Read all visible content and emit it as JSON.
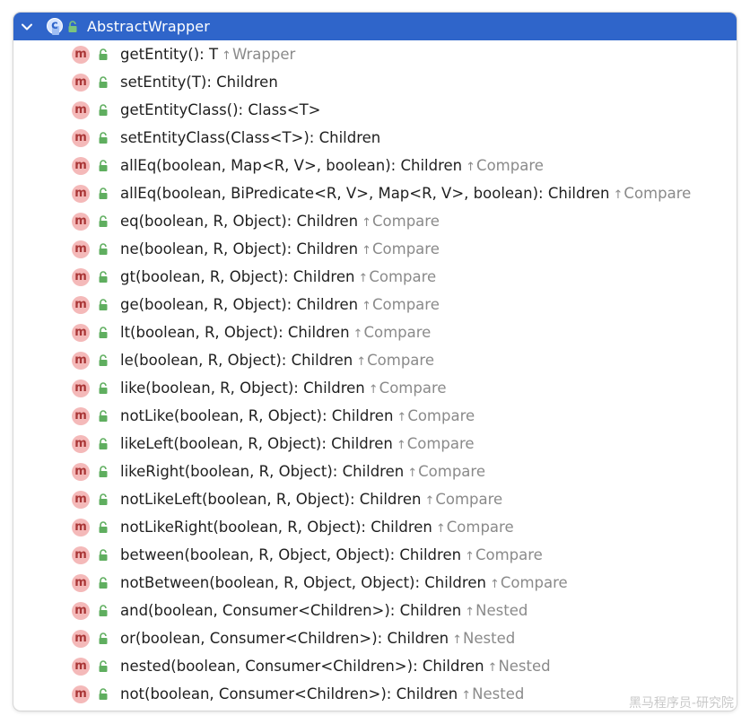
{
  "colors": {
    "header_bg": "#2f65ca",
    "method_icon": "#f4b9b9",
    "lock_green": "#5fae5f",
    "inherited_text": "#8a8a8a"
  },
  "header": {
    "class_icon_letter": "c",
    "title": "AbstractWrapper"
  },
  "method_icon_letter": "m",
  "methods": [
    {
      "signature": "getEntity(): T",
      "inherited": "Wrapper"
    },
    {
      "signature": "setEntity(T): Children",
      "inherited": ""
    },
    {
      "signature": "getEntityClass(): Class<T>",
      "inherited": ""
    },
    {
      "signature": "setEntityClass(Class<T>): Children",
      "inherited": ""
    },
    {
      "signature": "allEq(boolean, Map<R, V>, boolean): Children",
      "inherited": "Compare"
    },
    {
      "signature": "allEq(boolean, BiPredicate<R, V>, Map<R, V>, boolean): Children",
      "inherited": "Compare"
    },
    {
      "signature": "eq(boolean, R, Object): Children",
      "inherited": "Compare"
    },
    {
      "signature": "ne(boolean, R, Object): Children",
      "inherited": "Compare"
    },
    {
      "signature": "gt(boolean, R, Object): Children",
      "inherited": "Compare"
    },
    {
      "signature": "ge(boolean, R, Object): Children",
      "inherited": "Compare"
    },
    {
      "signature": "lt(boolean, R, Object): Children",
      "inherited": "Compare"
    },
    {
      "signature": "le(boolean, R, Object): Children",
      "inherited": "Compare"
    },
    {
      "signature": "like(boolean, R, Object): Children",
      "inherited": "Compare"
    },
    {
      "signature": "notLike(boolean, R, Object): Children",
      "inherited": "Compare"
    },
    {
      "signature": "likeLeft(boolean, R, Object): Children",
      "inherited": "Compare"
    },
    {
      "signature": "likeRight(boolean, R, Object): Children",
      "inherited": "Compare"
    },
    {
      "signature": "notLikeLeft(boolean, R, Object): Children",
      "inherited": "Compare"
    },
    {
      "signature": "notLikeRight(boolean, R, Object): Children",
      "inherited": "Compare"
    },
    {
      "signature": "between(boolean, R, Object, Object): Children",
      "inherited": "Compare"
    },
    {
      "signature": "notBetween(boolean, R, Object, Object): Children",
      "inherited": "Compare"
    },
    {
      "signature": "and(boolean, Consumer<Children>): Children",
      "inherited": "Nested"
    },
    {
      "signature": "or(boolean, Consumer<Children>): Children",
      "inherited": "Nested"
    },
    {
      "signature": "nested(boolean, Consumer<Children>): Children",
      "inherited": "Nested"
    },
    {
      "signature": "not(boolean, Consumer<Children>): Children",
      "inherited": "Nested"
    }
  ],
  "watermark": "黑马程序员-研究院"
}
